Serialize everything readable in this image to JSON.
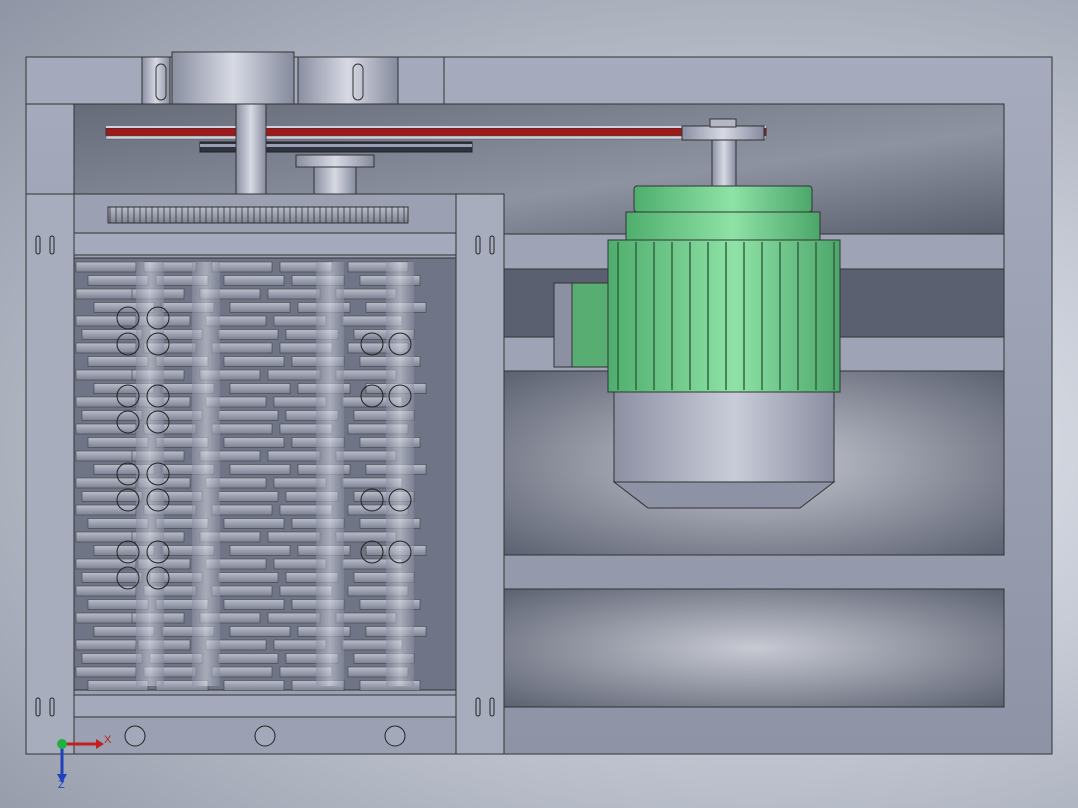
{
  "view": {
    "triad": {
      "x_label": "X",
      "z_label": "Z"
    }
  },
  "colors": {
    "frame": "#9ea3b5",
    "frame_dark": "#6f7486",
    "motor_green": "#6ccf8a",
    "motor_green_dark": "#3e9a5c",
    "motor_body": "#a9adbf",
    "belt_red": "#a01818",
    "opening_dark": "#5b6070"
  }
}
